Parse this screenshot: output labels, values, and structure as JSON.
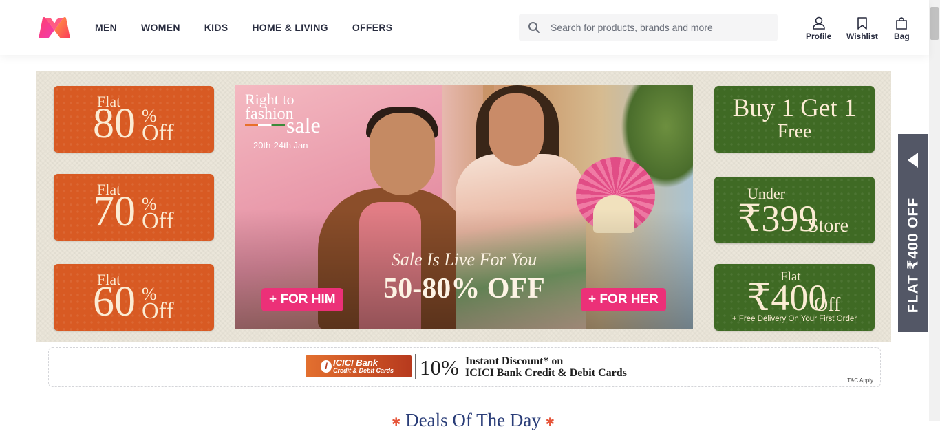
{
  "header": {
    "logo_name": "myntra-logo",
    "nav": [
      "MEN",
      "WOMEN",
      "KIDS",
      "HOME & LIVING",
      "OFFERS"
    ],
    "search": {
      "placeholder": "Search for products, brands and more",
      "value": ""
    },
    "actions": {
      "profile": "Profile",
      "wishlist": "Wishlist",
      "bag": "Bag"
    }
  },
  "banner": {
    "left_tiles": [
      {
        "label": "Flat",
        "number": "80",
        "pct": "%",
        "off": "Off"
      },
      {
        "label": "Flat",
        "number": "70",
        "pct": "%",
        "off": "Off"
      },
      {
        "label": "Flat",
        "number": "60",
        "pct": "%",
        "off": "Off"
      }
    ],
    "hero": {
      "line1": "Right to",
      "line2": "fashion",
      "line3": "sale",
      "dates": "20th-24th Jan",
      "tagline": "Sale Is Live For You",
      "discount": "50-80% OFF",
      "for_him": "+ FOR HIM",
      "for_her": "+ FOR HER"
    },
    "right_tiles": {
      "bogo_top": "Buy 1 Get 1",
      "bogo_bottom": "Free",
      "under": "Under",
      "under_price": "₹399",
      "under_store": "Store",
      "flat": "Flat",
      "flat_amount": "₹400",
      "flat_off": "Off",
      "flat_note": "+ Free Delivery On Your First Order"
    }
  },
  "side_tab": {
    "text": "FLAT ₹400 OFF"
  },
  "bank_offer": {
    "bank_name": "ICICI Bank",
    "bank_sub": "Credit & Debit Cards",
    "percent": "10%",
    "line1": "Instant Discount* on",
    "line2": "ICICI Bank Credit & Debit Cards",
    "tnc": "T&C Apply"
  },
  "section_title": "Deals Of The Day",
  "colors": {
    "brand_pink": "#ec3078",
    "tile_orange": "#d85a23",
    "tile_green": "#3f6a24",
    "side_tab": "#535766"
  }
}
